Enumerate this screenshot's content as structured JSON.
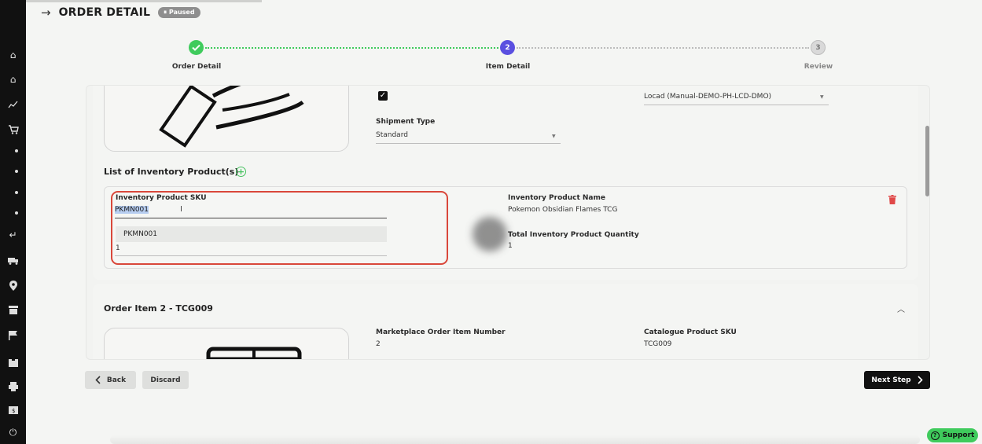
{
  "header": {
    "title": "ORDER DETAIL",
    "status": "Paused",
    "status_icon": "pause-icon"
  },
  "stepper": {
    "steps": [
      {
        "number": "",
        "label": "Order Detail",
        "state": "completed"
      },
      {
        "number": "2",
        "label": "Item Detail",
        "state": "active"
      },
      {
        "number": "3",
        "label": "Review",
        "state": "pending"
      }
    ]
  },
  "item1": {
    "shipping_location_value": "Locad (Manual-DEMO-PH-LCD-DMO)",
    "shipment_type_label": "Shipment Type",
    "shipment_type_value": "Standard",
    "inventory_section_title": "List of Inventory Product(s)",
    "inventory": {
      "sku_label": "Inventory Product SKU",
      "sku_value": "PKMN001",
      "sku_option": "PKMN001",
      "quantity_value": "1",
      "name_label": "Inventory Product Name",
      "name_value": "Pokemon Obsidian Flames TCG",
      "total_qty_label": "Total Inventory Product Quantity",
      "total_qty_value": "1"
    }
  },
  "item2": {
    "title": "Order Item 2 - TCG009",
    "marketplace_label": "Marketplace Order Item Number",
    "marketplace_value": "2",
    "catalogue_label": "Catalogue Product SKU",
    "catalogue_value": "TCG009"
  },
  "footer": {
    "back_label": "Back",
    "discard_label": "Discard",
    "next_label": "Next Step"
  },
  "support_label": "Support",
  "colors": {
    "success": "#3fcb5c",
    "active_step": "#5a4fe0",
    "highlight": "#d9473a",
    "danger": "#e04848"
  }
}
